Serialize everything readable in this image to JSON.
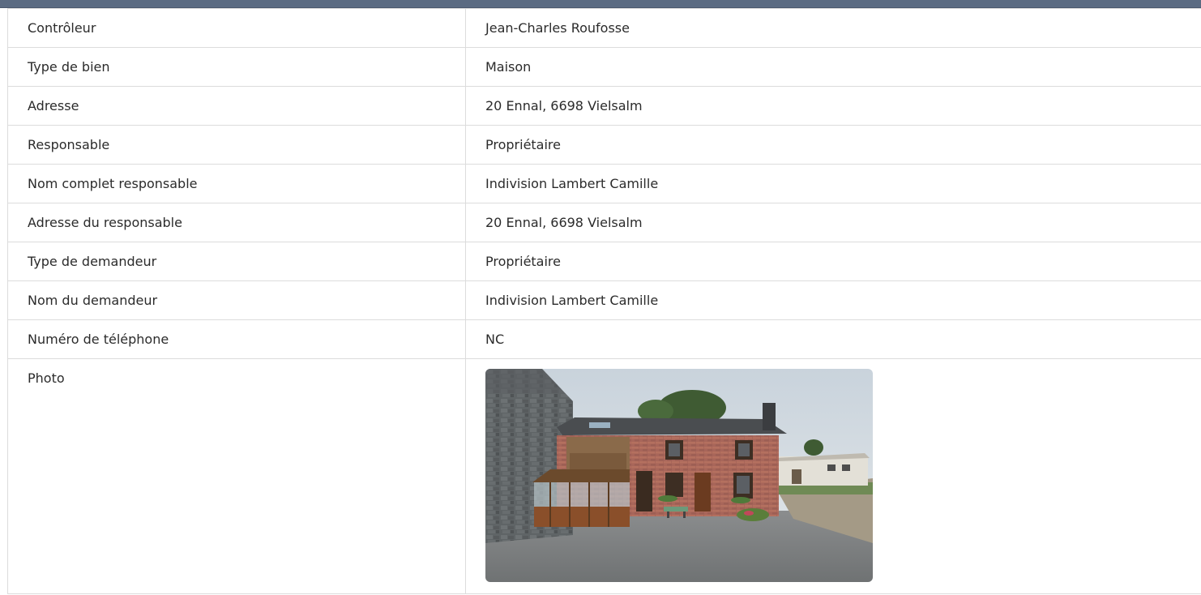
{
  "rows": [
    {
      "label": "Contrôleur",
      "value": "Jean-Charles Roufosse"
    },
    {
      "label": "Type de bien",
      "value": "Maison"
    },
    {
      "label": "Adresse",
      "value": "20 Ennal, 6698 Vielsalm"
    },
    {
      "label": "Responsable",
      "value": "Propriétaire"
    },
    {
      "label": "Nom complet responsable",
      "value": "Indivision Lambert Camille"
    },
    {
      "label": "Adresse du responsable",
      "value": "20 Ennal, 6698 Vielsalm"
    },
    {
      "label": "Type de demandeur",
      "value": "Propriétaire"
    },
    {
      "label": "Nom du demandeur",
      "value": "Indivision Lambert Camille"
    },
    {
      "label": "Numéro de téléphone",
      "value": "NC"
    }
  ],
  "photo": {
    "label": "Photo"
  },
  "colors": {
    "header_bar": "#5b6b82",
    "border": "#dcdcdc",
    "text": "#2b2b2b"
  }
}
